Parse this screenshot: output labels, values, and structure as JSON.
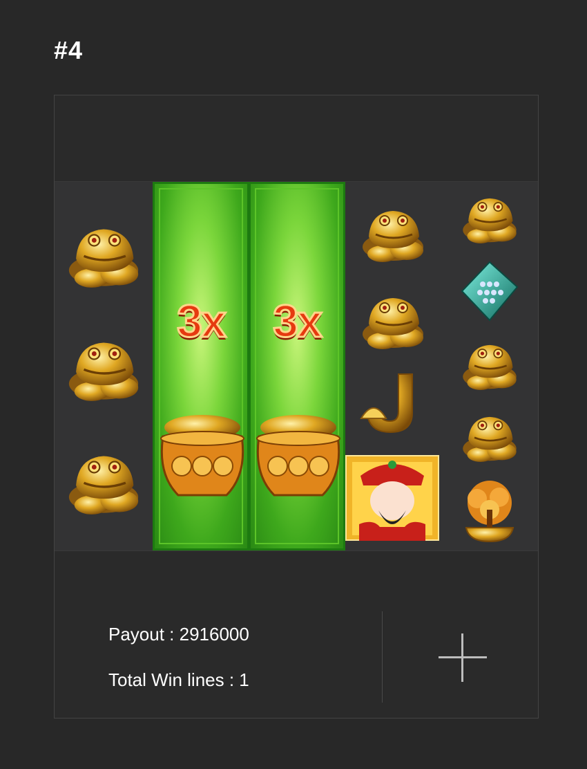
{
  "header": {
    "title": "#4"
  },
  "multipliers": [
    "3x",
    "3x"
  ],
  "result": {
    "payout_label": "Payout : 2916000",
    "win_lines_label": "Total Win lines : 1"
  },
  "reels": {
    "col1": [
      "toad",
      "toad",
      "toad"
    ],
    "col2": [
      "wild-multiplier-pot"
    ],
    "col3": [
      "wild-multiplier-pot"
    ],
    "col4": [
      "toad",
      "toad",
      "letter-j",
      "god-of-wealth"
    ],
    "col5": [
      "toad",
      "jade-abacus",
      "toad",
      "toad",
      "money-tree"
    ]
  }
}
